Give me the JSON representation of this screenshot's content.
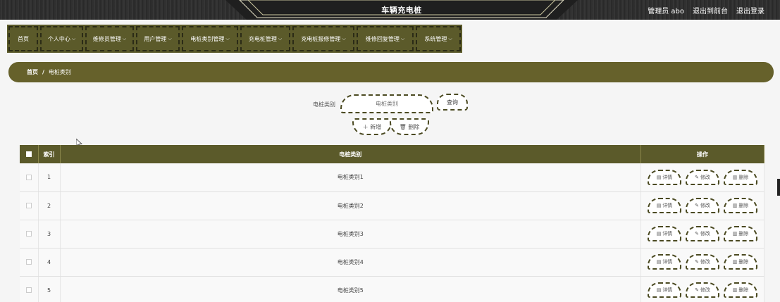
{
  "header": {
    "title": "车辆充电桩",
    "user_label": "管理员 abo",
    "to_frontend": "退出到前台",
    "logout": "退出登录"
  },
  "nav": [
    {
      "label": "首页",
      "has_menu": false
    },
    {
      "label": "个人中心",
      "has_menu": true
    },
    {
      "label": "维修员管理",
      "has_menu": true
    },
    {
      "label": "用户管理",
      "has_menu": true
    },
    {
      "label": "电桩类别管理",
      "has_menu": true
    },
    {
      "label": "充电桩管理",
      "has_menu": true
    },
    {
      "label": "充电桩报修管理",
      "has_menu": true
    },
    {
      "label": "维修回复管理",
      "has_menu": true
    },
    {
      "label": "系统管理",
      "has_menu": true
    }
  ],
  "breadcrumb": {
    "home": "首页",
    "separator": "/",
    "current": "电桩类别"
  },
  "search": {
    "label": "电桩类别",
    "placeholder": "电桩类别",
    "query_button": "查询"
  },
  "actions": {
    "add": "新增",
    "delete": "删除"
  },
  "table": {
    "headers": {
      "index": "索引",
      "category": "电桩类别",
      "ops": "操作"
    },
    "row_actions": {
      "detail": "详情",
      "edit": "修改",
      "delete": "删除"
    },
    "rows": [
      {
        "index": "1",
        "category": "电桩类别1"
      },
      {
        "index": "2",
        "category": "电桩类别2"
      },
      {
        "index": "3",
        "category": "电桩类别3"
      },
      {
        "index": "4",
        "category": "电桩类别4"
      },
      {
        "index": "5",
        "category": "电桩类别5"
      }
    ]
  },
  "colors": {
    "accent": "#5b5a2a",
    "breadcrumb_bg": "#66612b",
    "header_bg": "#2b2b2b"
  }
}
